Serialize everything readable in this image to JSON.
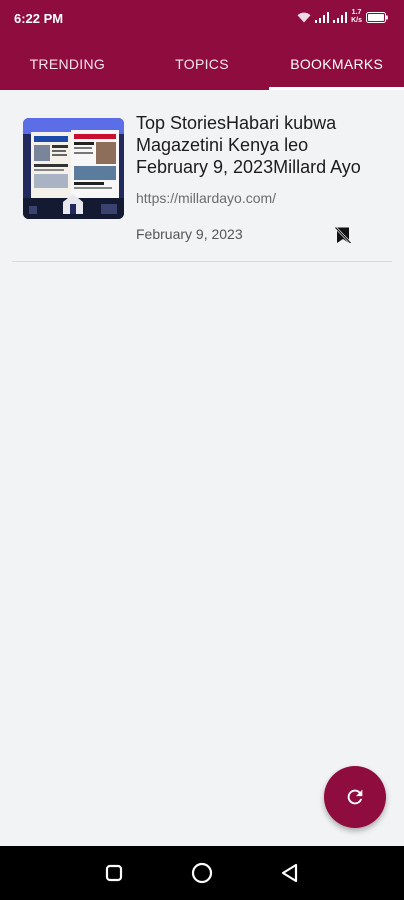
{
  "status_bar": {
    "time": "6:22 PM",
    "speed_top": "1.7",
    "speed_bottom": "K/s",
    "icons": [
      "wifi-icon",
      "signal-icon",
      "signal-icon",
      "battery-icon"
    ]
  },
  "tabs": [
    {
      "label": "TRENDING",
      "active": false
    },
    {
      "label": "TOPICS",
      "active": false
    },
    {
      "label": "BOOKMARKS",
      "active": true
    }
  ],
  "articles": [
    {
      "title": "Top StoriesHabari kubwa Magazetini Kenya leo February 9, 2023Millard Ayo",
      "url": "https://millardayo.com/",
      "date": "February 9, 2023",
      "bookmark_icon": "bookmark-remove-icon"
    }
  ],
  "fab": {
    "icon": "refresh-icon"
  },
  "nav_bar": {
    "icons": [
      "recents-icon",
      "home-icon",
      "back-icon"
    ]
  },
  "colors": {
    "primary": "#8f0c3e",
    "background": "#f2f3f5"
  }
}
